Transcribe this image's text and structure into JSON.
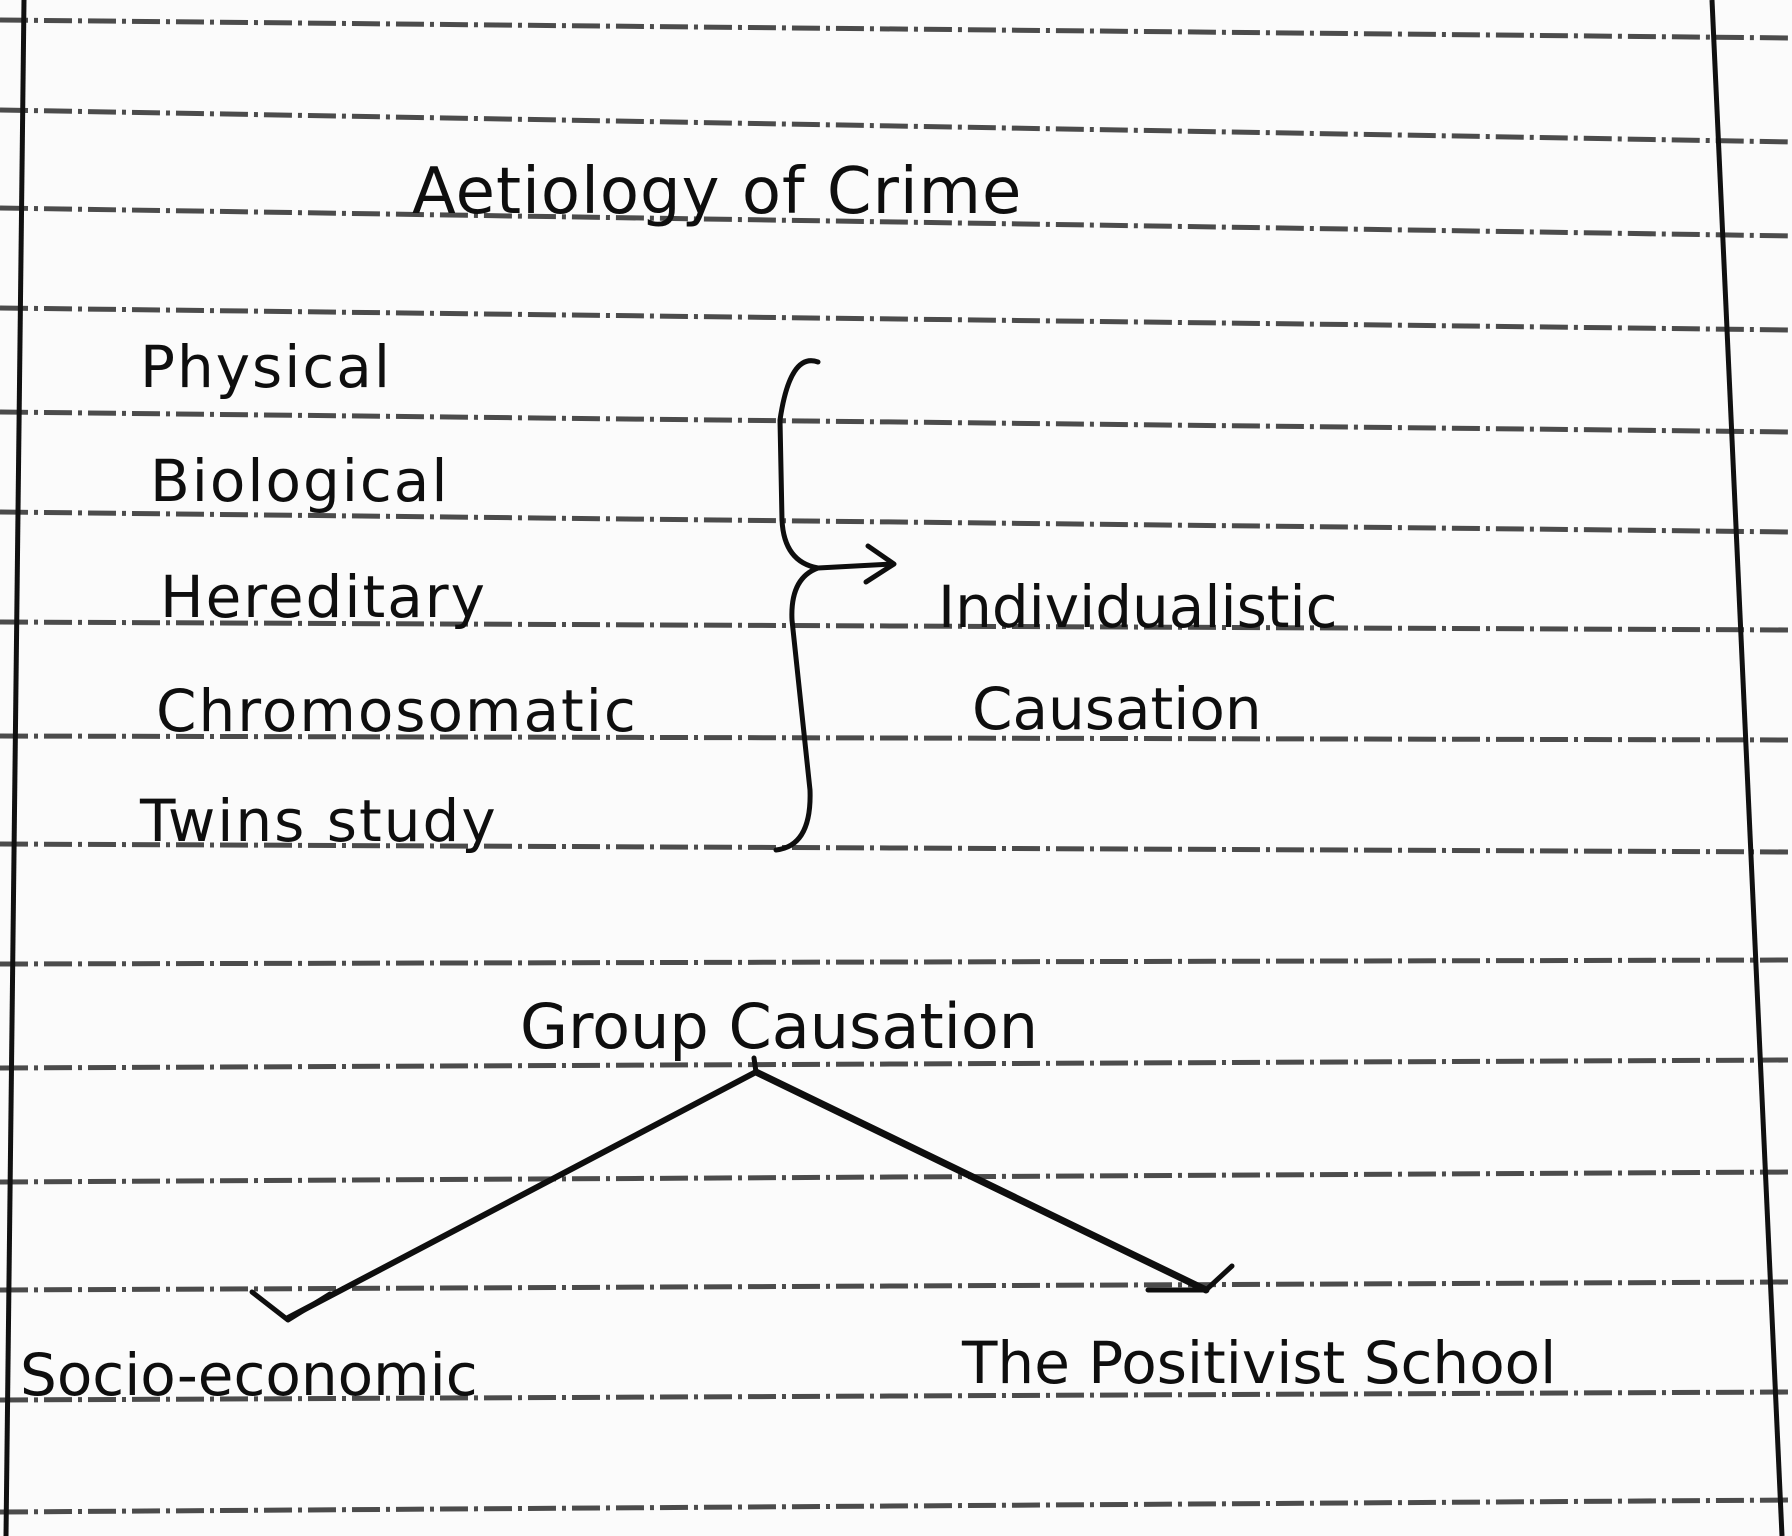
{
  "title": "Aetiology of Crime",
  "factors": [
    "Physical",
    "Biological",
    "Hereditary",
    "Chromosomatic",
    "Twins study"
  ],
  "individualistic_result": {
    "line1": "Individualistic",
    "line2": "Causation"
  },
  "group_causation": {
    "label": "Group Causation",
    "branches": [
      "Socio-economic",
      "The Positivist School"
    ]
  },
  "colors": {
    "ink": "#0e0e0e",
    "paper": "#fbfbfb",
    "rule": "#1a1a1a"
  },
  "icons": {
    "brace": "right-curly-brace-icon",
    "arrow": "right-arrow-icon",
    "branch_arrows": "down-arrow-icon"
  }
}
